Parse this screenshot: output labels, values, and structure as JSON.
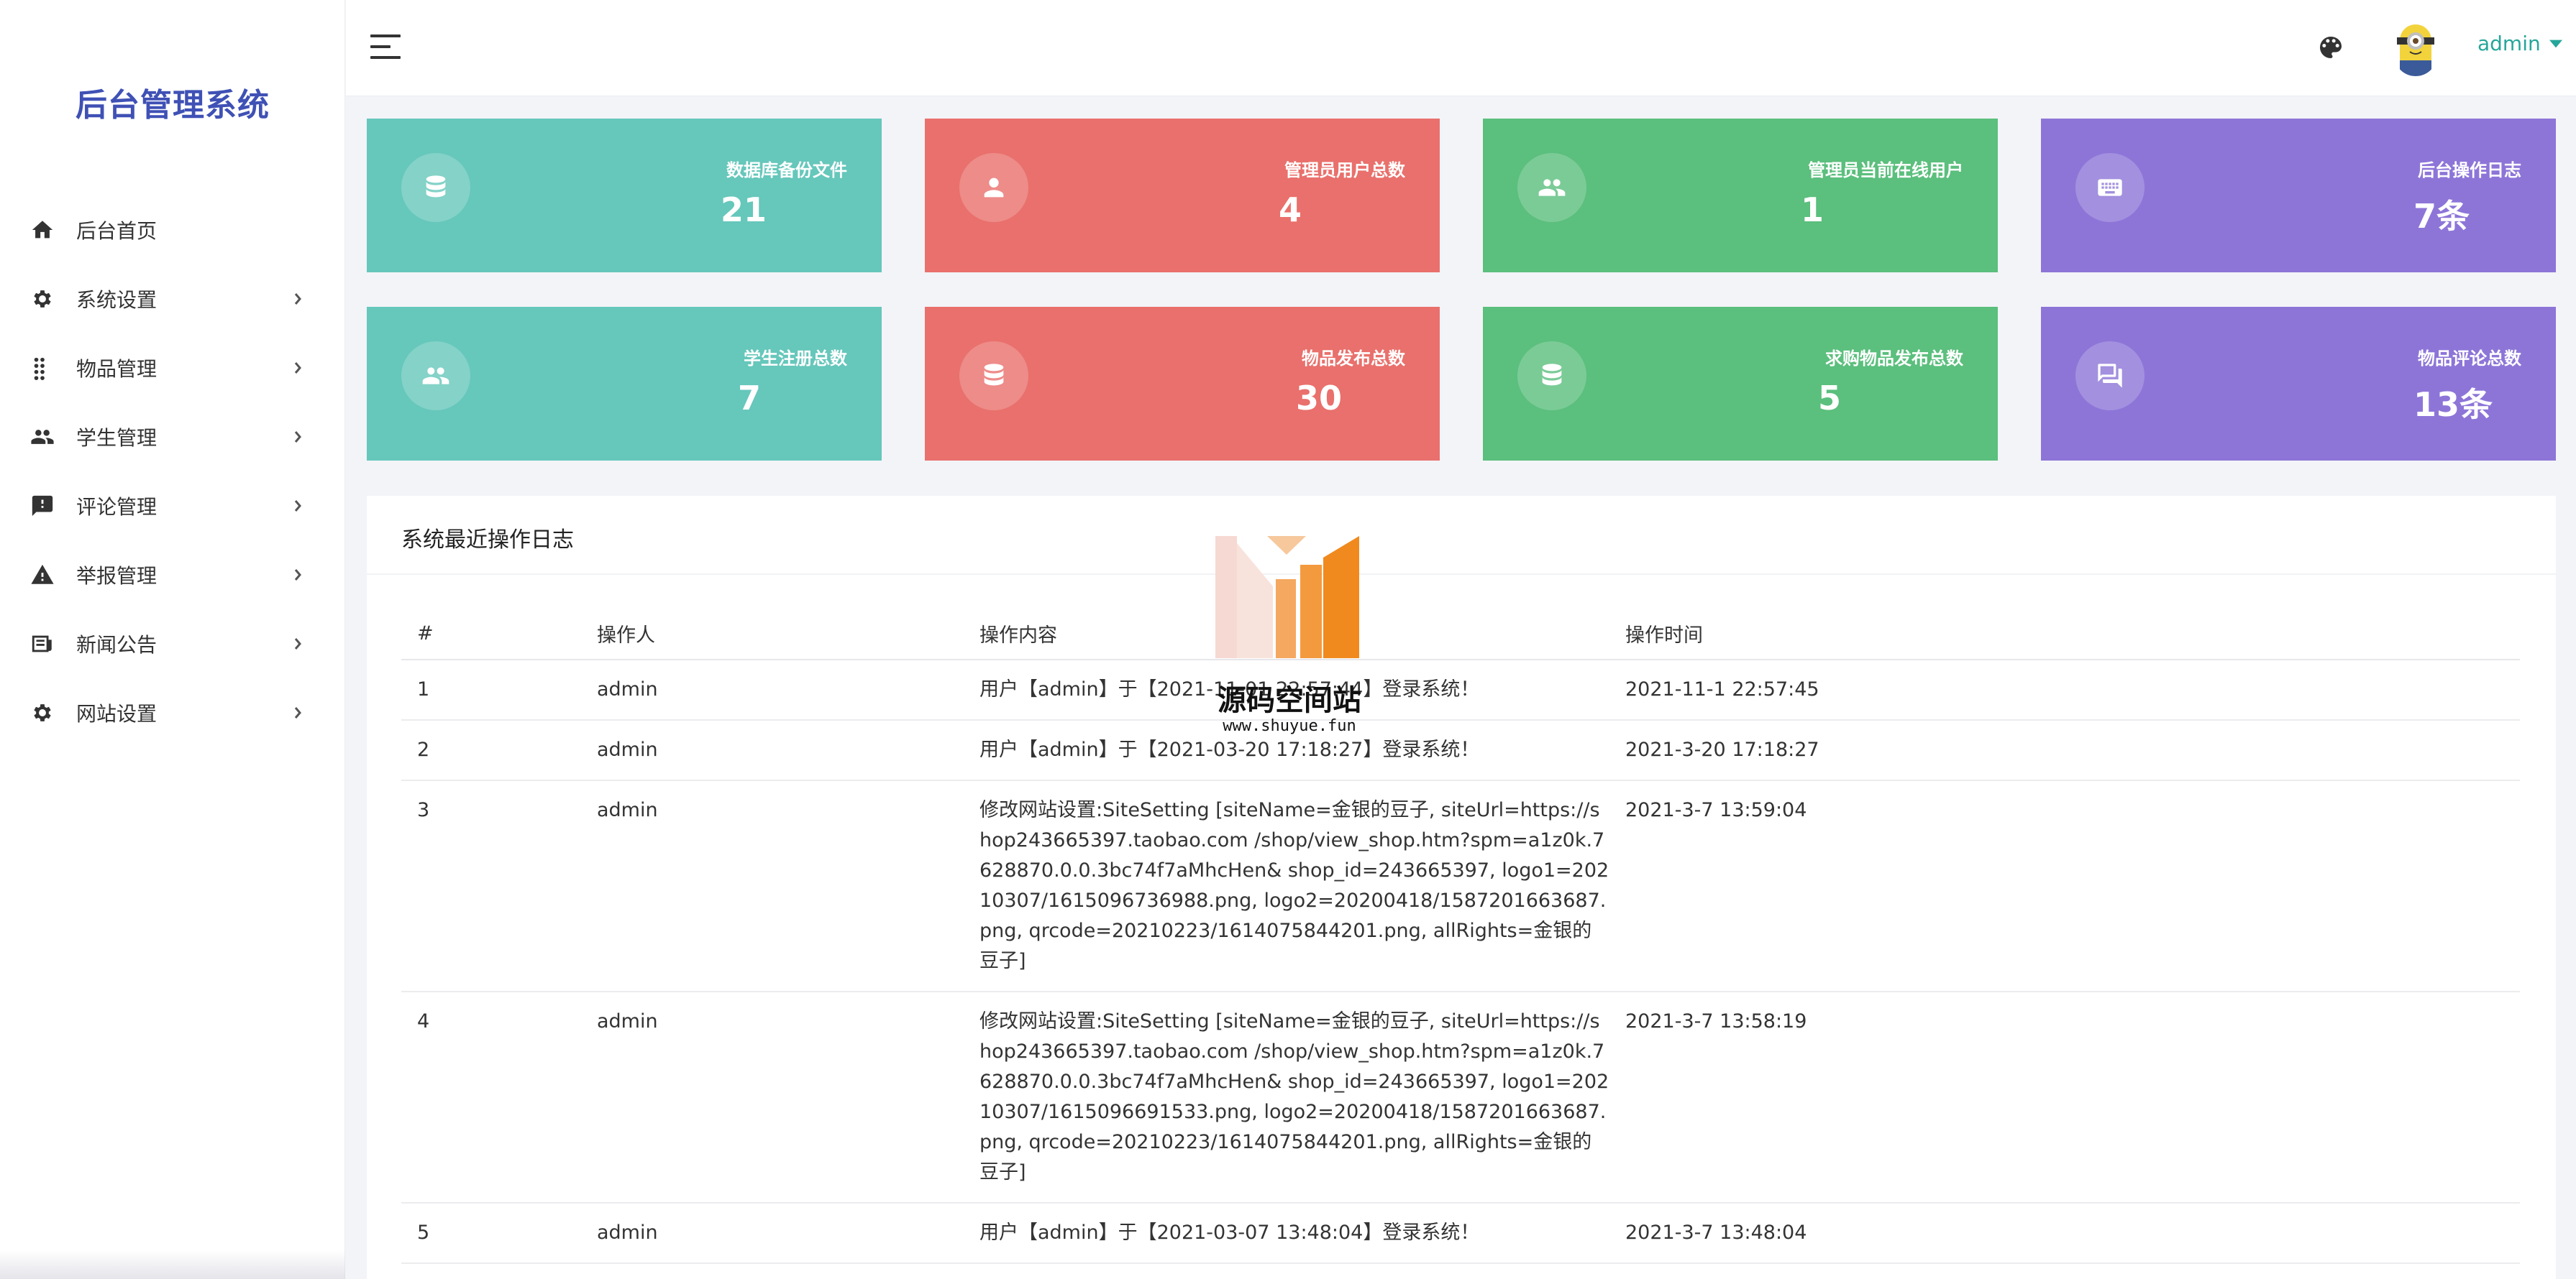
{
  "sidebar": {
    "brand": "后台管理系统",
    "items": [
      {
        "label": "后台首页",
        "icon": "home-icon",
        "has_children": false
      },
      {
        "label": "系统设置",
        "icon": "gear-icon",
        "has_children": true
      },
      {
        "label": "物品管理",
        "icon": "grid-icon",
        "has_children": true
      },
      {
        "label": "学生管理",
        "icon": "people-icon",
        "has_children": true
      },
      {
        "label": "评论管理",
        "icon": "comment-alert-icon",
        "has_children": true
      },
      {
        "label": "举报管理",
        "icon": "warning-icon",
        "has_children": true
      },
      {
        "label": "新闻公告",
        "icon": "news-icon",
        "has_children": true
      },
      {
        "label": "网站设置",
        "icon": "gear-icon",
        "has_children": true
      }
    ]
  },
  "header": {
    "username": "admin",
    "colors": {
      "accent": "#26a69a"
    }
  },
  "stats": [
    {
      "label": "数据库备份文件",
      "value": "21",
      "icon": "database-icon",
      "color": "#66c7bb"
    },
    {
      "label": "管理员用户总数",
      "value": "4",
      "icon": "person-icon",
      "color": "#e9706c"
    },
    {
      "label": "管理员当前在线用户",
      "value": "1",
      "icon": "people-icon",
      "color": "#5bbf7d"
    },
    {
      "label": "后台操作日志",
      "value": "7条",
      "icon": "keyboard-icon",
      "color": "#8d75d8"
    },
    {
      "label": "学生注册总数",
      "value": "7",
      "icon": "people-icon",
      "color": "#66c7bb"
    },
    {
      "label": "物品发布总数",
      "value": "30",
      "icon": "database-icon",
      "color": "#e9706c"
    },
    {
      "label": "求购物品发布总数",
      "value": "5",
      "icon": "database-icon",
      "color": "#5bbf7d"
    },
    {
      "label": "物品评论总数",
      "value": "13条",
      "icon": "comments-icon",
      "color": "#8d75d8"
    }
  ],
  "log": {
    "title": "系统最近操作日志",
    "columns": [
      "#",
      "操作人",
      "操作内容",
      "操作时间"
    ],
    "rows": [
      {
        "id": "1",
        "user": "admin",
        "content": "用户【admin】于【2021-11-01 22:57:44】登录系统！",
        "time": "2021-11-1 22:57:45"
      },
      {
        "id": "2",
        "user": "admin",
        "content": "用户【admin】于【2021-03-20 17:18:27】登录系统！",
        "time": "2021-3-20 17:18:27"
      },
      {
        "id": "3",
        "user": "admin",
        "content": "修改网站设置:SiteSetting [siteName=金银的豆子, siteUrl=https://shop243665397.taobao.com /shop/view_shop.htm?spm=a1z0k.7628870.0.0.3bc74f7aMhcHen& shop_id=243665397, logo1=20210307/1615096736988.png, logo2=20200418/1587201663687.png, qrcode=20210223/1614075844201.png, allRights=金银的豆子]",
        "time": "2021-3-7 13:59:04"
      },
      {
        "id": "4",
        "user": "admin",
        "content": "修改网站设置:SiteSetting [siteName=金银的豆子, siteUrl=https://shop243665397.taobao.com /shop/view_shop.htm?spm=a1z0k.7628870.0.0.3bc74f7aMhcHen& shop_id=243665397, logo1=20210307/1615096691533.png, logo2=20200418/1587201663687.png, qrcode=20210223/1614075844201.png, allRights=金银的豆子]",
        "time": "2021-3-7 13:58:19"
      },
      {
        "id": "5",
        "user": "admin",
        "content": "用户【admin】于【2021-03-07 13:48:04】登录系统！",
        "time": "2021-3-7 13:48:04"
      }
    ]
  },
  "watermark": {
    "title": "源码空间站",
    "url": "www.shuyue.fun"
  }
}
